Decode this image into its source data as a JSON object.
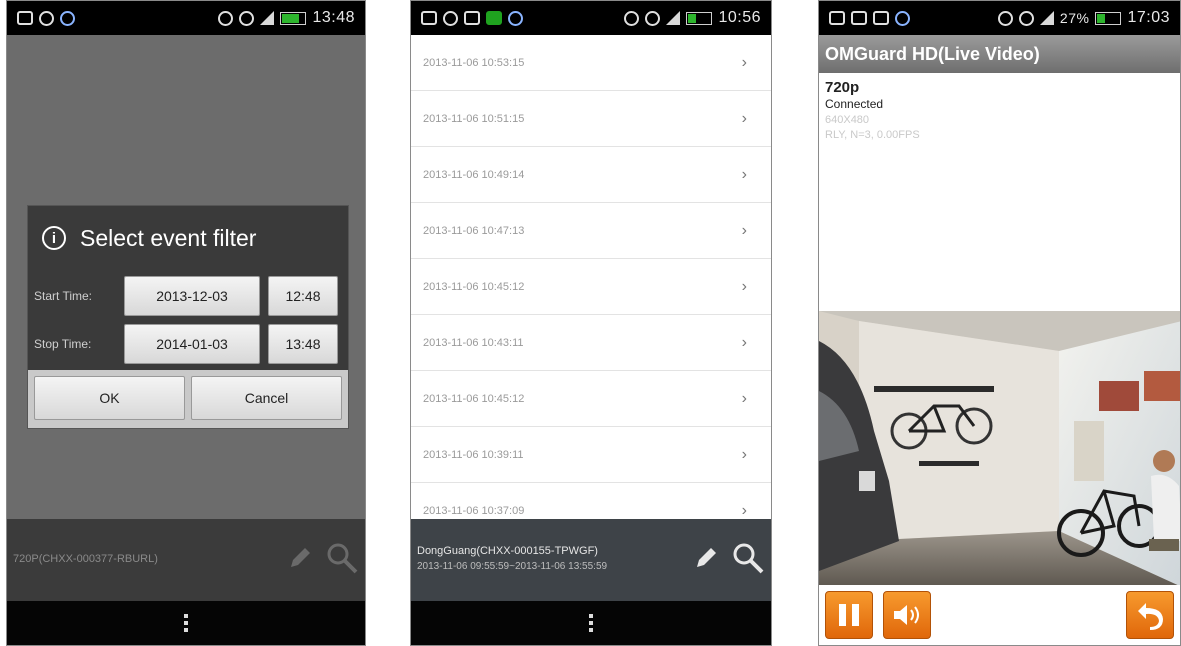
{
  "colors": {
    "dialog_bg": "#3a3a3a",
    "status_bar_bg": "#000000",
    "orange_button": "#f08a1f",
    "battery_green": "#2db52d"
  },
  "phone1": {
    "status": {
      "time": "13:48"
    },
    "dialog": {
      "title": "Select event filter",
      "start_label": "Start Time:",
      "start_date": "2013-12-03",
      "start_time": "12:48",
      "stop_label": "Stop Time:",
      "stop_date": "2014-01-03",
      "stop_time": "13:48",
      "ok": "OK",
      "cancel": "Cancel"
    },
    "device_text": "720P(CHXX-000377-RBURL)"
  },
  "phone2": {
    "status": {
      "time": "10:56"
    },
    "events": [
      "2013-11-06 10:53:15",
      "2013-11-06 10:51:15",
      "2013-11-06 10:49:14",
      "2013-11-06 10:47:13",
      "2013-11-06 10:45:12",
      "2013-11-06 10:43:11",
      "2013-11-06 10:45:12",
      "2013-11-06 10:39:11",
      "2013-11-06 10:37:09"
    ],
    "device_name": "DongGuang(CHXX-000155-TPWGF)",
    "range": "2013-11-06 09:55:59~2013-11-06 13:55:59"
  },
  "phone3": {
    "status": {
      "battery": "27%",
      "time": "17:03"
    },
    "title": "OMGuard HD(Live Video)",
    "resolution": "720p",
    "connection": "Connected",
    "size": "640X480",
    "stats": "RLY, N=3, 0.00FPS"
  }
}
